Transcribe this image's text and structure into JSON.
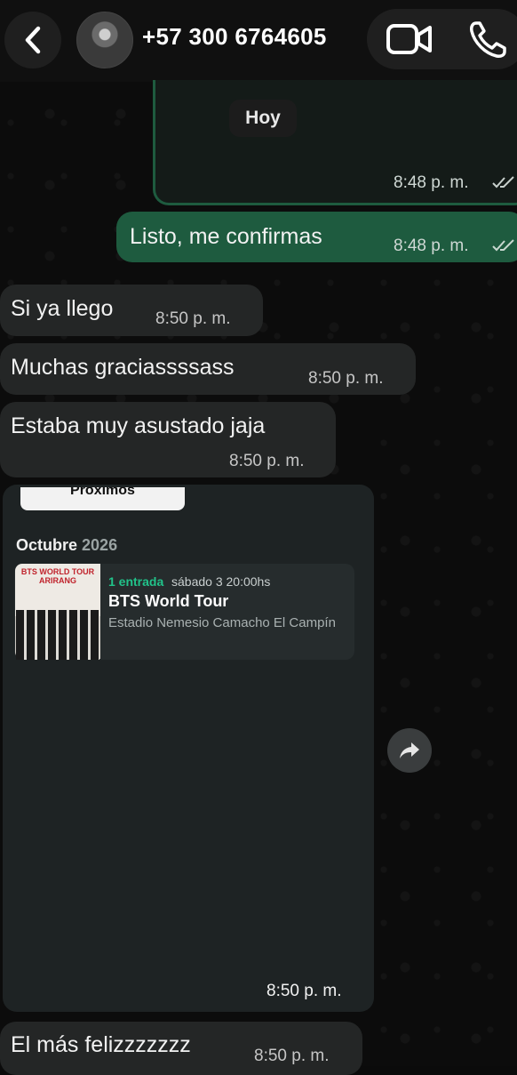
{
  "header": {
    "contact": "+57 300 6764605",
    "back_icon": "chevron-left-icon",
    "video_icon": "video-camera-icon",
    "call_icon": "phone-icon"
  },
  "date_separator": "Hoy",
  "messages": [
    {
      "dir": "out",
      "text": "",
      "time": "8:48 p. m."
    },
    {
      "dir": "out",
      "text": "Listo, me confirmas",
      "time": "8:48 p. m."
    },
    {
      "dir": "in",
      "text": "Si ya llego",
      "time": "8:50 p. m."
    },
    {
      "dir": "in",
      "text": "Muchas graciassssass",
      "time": "8:50 p. m."
    },
    {
      "dir": "in",
      "text": "Estaba muy asustado jaja",
      "time": "8:50 p. m."
    },
    {
      "dir": "in",
      "text": "",
      "time": "8:50 p. m."
    },
    {
      "dir": "in",
      "text": "El más felizzzzzzz",
      "time": "8:50 p. m."
    }
  ],
  "ticket_image": {
    "tab_label": "Próximos",
    "month": "Octubre",
    "year": "2026",
    "poster_text": "BTS WORLD TOUR ARIRANG",
    "quantity": "1 entrada",
    "date": "sábado 3 20:00hs",
    "title": "BTS World Tour",
    "venue": "Estadio Nemesio Camacho El Campín"
  },
  "colors": {
    "outgoing": "#1e5b3f",
    "incoming": "#242626",
    "accent": "#21c38a"
  }
}
